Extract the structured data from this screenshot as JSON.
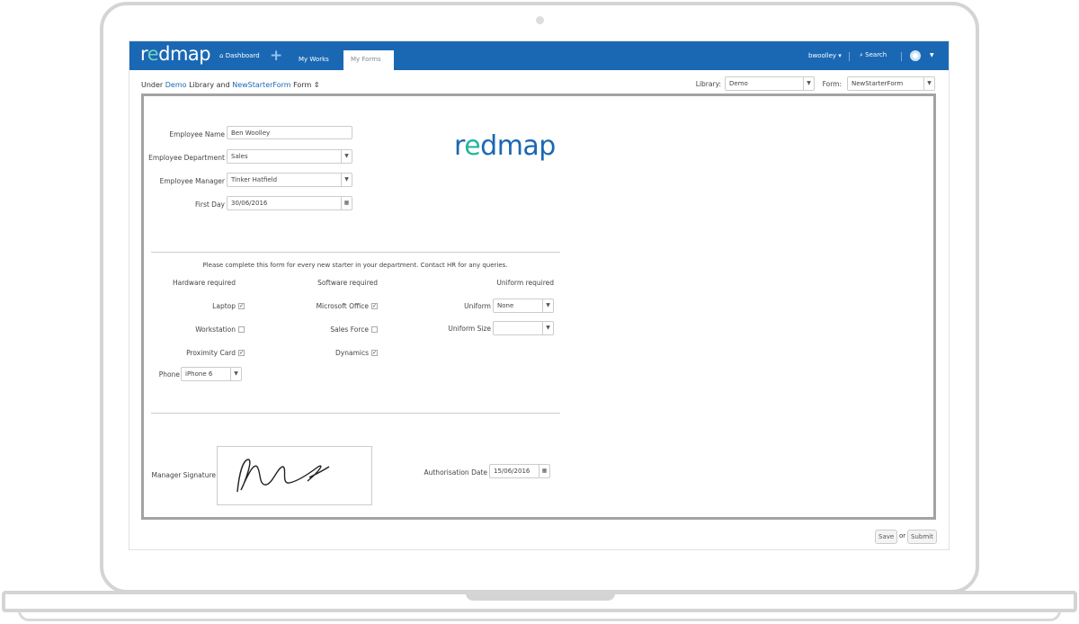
{
  "nav": {
    "logo": "redmap",
    "dashboard": "Dashboard",
    "add_icon": "plus-icon",
    "my_works": "My Works",
    "my_forms": "My Forms",
    "user": "bwoolley ▾",
    "search": "Search"
  },
  "header": {
    "under": "Under ",
    "library_link": "Demo",
    "library_text": " Library and ",
    "form_link": "NewStarterForm",
    "form_text": " Form",
    "library_label": "Library:",
    "library_value": "Demo",
    "form_label": "Form:",
    "form_value": "NewStarterForm"
  },
  "form": {
    "employee_name_label": "Employee Name",
    "employee_name": "Ben Woolley",
    "department_label": "Employee Department",
    "department": "Sales",
    "manager_label": "Employee Manager",
    "manager": "Tinker Hatfield",
    "first_day_label": "First Day",
    "first_day": "30/06/2016",
    "logo": "redmap",
    "instructions": "Please complete this form for every new starter in your department. Contact HR for any queries.",
    "hardware_title": "Hardware required",
    "software_title": "Software required",
    "uniform_title": "Uniform required",
    "hardware": [
      {
        "label": "Laptop",
        "checked": true
      },
      {
        "label": "Workstation",
        "checked": false
      },
      {
        "label": "Proximity Card",
        "checked": true
      }
    ],
    "software": [
      {
        "label": "Microsoft Office",
        "checked": true
      },
      {
        "label": "Sales Force",
        "checked": false
      },
      {
        "label": "Dynamics",
        "checked": true
      }
    ],
    "uniform_label": "Uniform",
    "uniform": "None",
    "uniform_size_label": "Uniform Size",
    "uniform_size": "",
    "phone_label": "Phone",
    "phone": "iPhone 6",
    "signature_label": "Manager Signature",
    "auth_date_label": "Authorisation Date",
    "auth_date": "15/06/2016"
  },
  "actions": {
    "save": "Save",
    "or": "or",
    "submit": "Submit"
  }
}
